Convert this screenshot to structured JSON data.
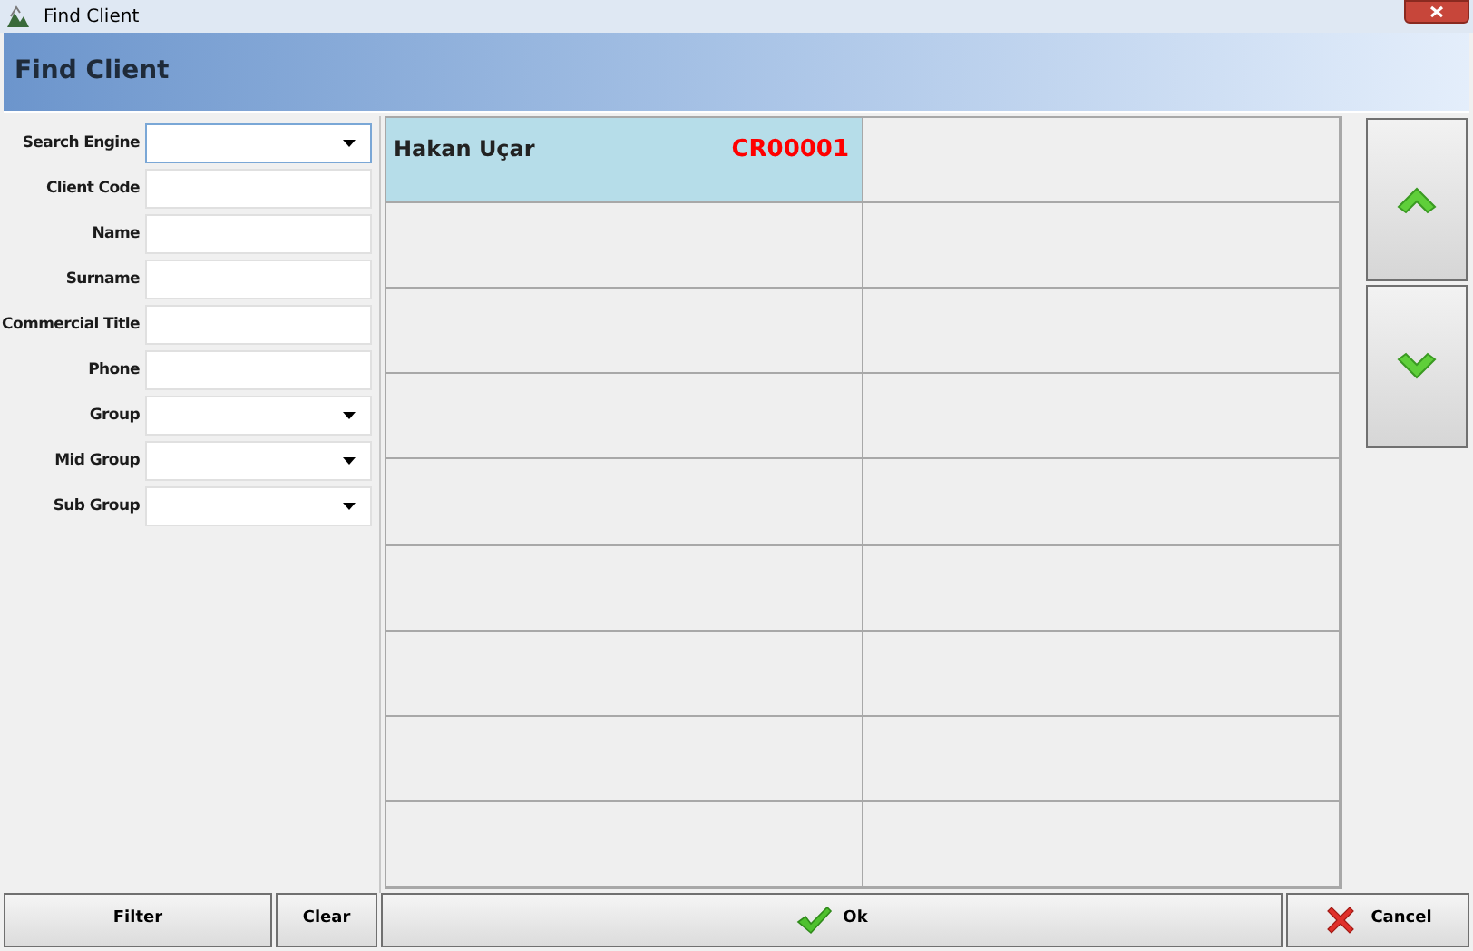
{
  "window": {
    "title": "Find Client"
  },
  "header": {
    "title": "Find Client"
  },
  "filters": [
    {
      "label": "Search Engine",
      "kind": "dropdown",
      "focused": true
    },
    {
      "label": "Client Code",
      "kind": "text",
      "focused": false
    },
    {
      "label": "Name",
      "kind": "text",
      "focused": false
    },
    {
      "label": "Surname",
      "kind": "text",
      "focused": false
    },
    {
      "label": "Commercial Title",
      "kind": "text",
      "focused": false
    },
    {
      "label": "Phone",
      "kind": "text",
      "focused": false
    },
    {
      "label": "Group",
      "kind": "dropdown",
      "focused": false
    },
    {
      "label": "Mid Group",
      "kind": "dropdown",
      "focused": false
    },
    {
      "label": "Sub Group",
      "kind": "dropdown",
      "focused": false
    }
  ],
  "results": [
    {
      "name": "Hakan Uçar",
      "code": "CR00001",
      "selected": true
    }
  ],
  "buttons": {
    "filter": "Filter",
    "clear": "Clear",
    "ok": "Ok",
    "cancel": "Cancel"
  }
}
